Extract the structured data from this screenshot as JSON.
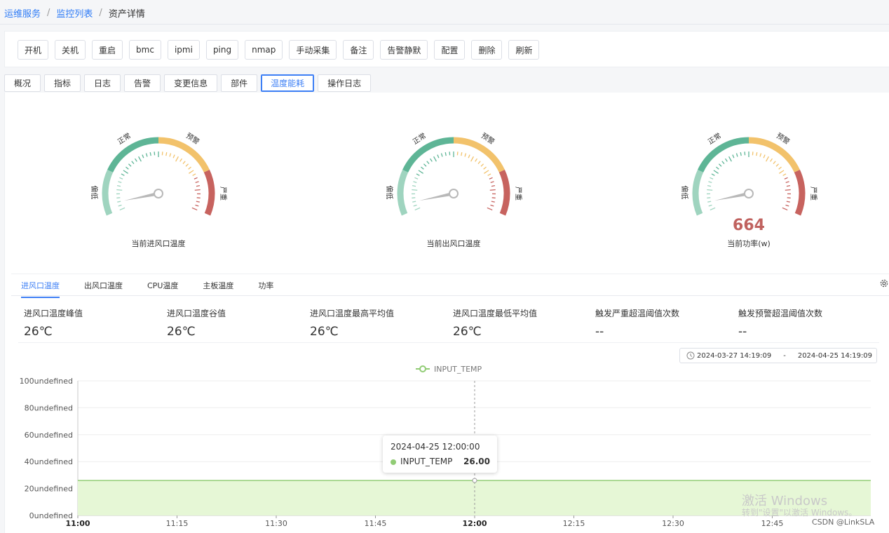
{
  "breadcrumb": {
    "items": [
      "运维服务",
      "监控列表",
      "资产详情"
    ],
    "separator": "/"
  },
  "toolbar": {
    "buttons": [
      "开机",
      "关机",
      "重启",
      "bmc",
      "ipmi",
      "ping",
      "nmap",
      "手动采集",
      "备注",
      "告警静默",
      "配置",
      "删除",
      "刷新"
    ]
  },
  "tabs": {
    "items": [
      "概况",
      "指标",
      "日志",
      "告警",
      "变更信息",
      "部件",
      "温度能耗",
      "操作日志"
    ],
    "active": "温度能耗"
  },
  "gauges": [
    {
      "caption": "当前进风口温度",
      "value": "",
      "level": 0.05
    },
    {
      "caption": "当前出风口温度",
      "value": "",
      "level": 0.05
    },
    {
      "caption": "当前功率(w)",
      "value": "664",
      "level": 0.05
    }
  ],
  "gauge_labels": {
    "low": "偏低",
    "normal": "正常",
    "warning": "预警",
    "severe": "严重"
  },
  "colors": {
    "low": "#9fd4bf",
    "normal": "#5eb596",
    "warning": "#f2c26b",
    "severe": "#c7635f",
    "accent": "#3d7ff5",
    "series": "#91cc75"
  },
  "metric_tabs": {
    "items": [
      "进风口温度",
      "出风口温度",
      "CPU温度",
      "主板温度",
      "功率"
    ],
    "active": "进风口温度"
  },
  "stats": [
    {
      "label": "进风口温度峰值",
      "value": "26℃"
    },
    {
      "label": "进风口温度谷值",
      "value": "26℃"
    },
    {
      "label": "进风口温度最高平均值",
      "value": "26℃"
    },
    {
      "label": "进风口温度最低平均值",
      "value": "26℃"
    },
    {
      "label": "触发严重超温阈值次数",
      "value": "--"
    },
    {
      "label": "触发预警超温阈值次数",
      "value": "--"
    }
  ],
  "date_range": {
    "start": "2024-03-27 14:19:09",
    "separator": "-",
    "end": "2024-04-25 14:19:09"
  },
  "chart_data": {
    "type": "area",
    "legend": [
      "INPUT_TEMP"
    ],
    "legend_position": "top-center",
    "x": [
      "11:00",
      "11:15",
      "11:30",
      "11:45",
      "12:00",
      "12:15",
      "12:30",
      "12:45"
    ],
    "series": [
      {
        "name": "INPUT_TEMP",
        "values": [
          26,
          26,
          26,
          26,
          26,
          26,
          26,
          26,
          26
        ]
      }
    ],
    "y_ticks": [
      "0undefined",
      "20undefined",
      "40undefined",
      "60undefined",
      "80undefined",
      "100undefined"
    ],
    "ylim": [
      0,
      100
    ],
    "grid": true,
    "tooltip": {
      "title": "2024-04-25 12:00:00",
      "name": "INPUT_TEMP",
      "value": "26.00"
    }
  },
  "watermark": {
    "line1": "激活 Windows",
    "line2": "转到\"设置\"以激活 Windows。"
  },
  "credit": "CSDN @LinkSLA"
}
